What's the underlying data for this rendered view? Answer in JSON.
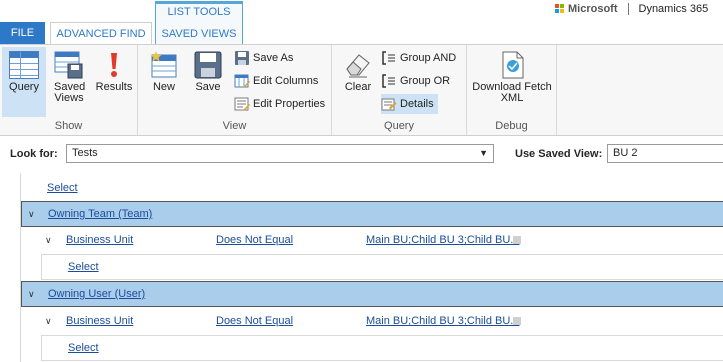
{
  "tabs": {
    "file": "FILE",
    "advanced_find": "ADVANCED FIND",
    "context_group": "LIST TOOLS",
    "saved_views": "SAVED VIEWS"
  },
  "brand": {
    "microsoft": "Microsoft",
    "product": "Dynamics 365"
  },
  "ribbon": {
    "show": {
      "label": "Show",
      "query": "Query",
      "saved_views": "Saved Views",
      "results": "Results"
    },
    "view": {
      "label": "View",
      "new": "New",
      "save": "Save",
      "save_as": "Save As",
      "edit_columns": "Edit Columns",
      "edit_properties": "Edit Properties"
    },
    "query": {
      "label": "Query",
      "clear": "Clear",
      "group_and": "Group AND",
      "group_or": "Group OR",
      "details": "Details"
    },
    "debug": {
      "label": "Debug",
      "download_fetch_xml": "Download Fetch XML"
    }
  },
  "filter": {
    "look_for_label": "Look for:",
    "look_for_value": "Tests",
    "use_saved_view_label": "Use Saved View:",
    "saved_view_value": "BU 2"
  },
  "tree": {
    "root_select": "Select",
    "entities": [
      {
        "name": "Owning Team (Team)",
        "condition": {
          "field": "Business Unit",
          "operator": "Does Not Equal",
          "value": "Main BU;Child BU 3;Child BU..."
        },
        "select": "Select"
      },
      {
        "name": "Owning User (User)",
        "condition": {
          "field": "Business Unit",
          "operator": "Does Not Equal",
          "value": "Main BU;Child BU 3;Child BU..."
        },
        "select": "Select"
      }
    ]
  },
  "colors": {
    "file_tab": "#2e79c7",
    "entity_row": "#abcdec",
    "active_button": "#cde3f5",
    "link": "#1a4d9a"
  }
}
